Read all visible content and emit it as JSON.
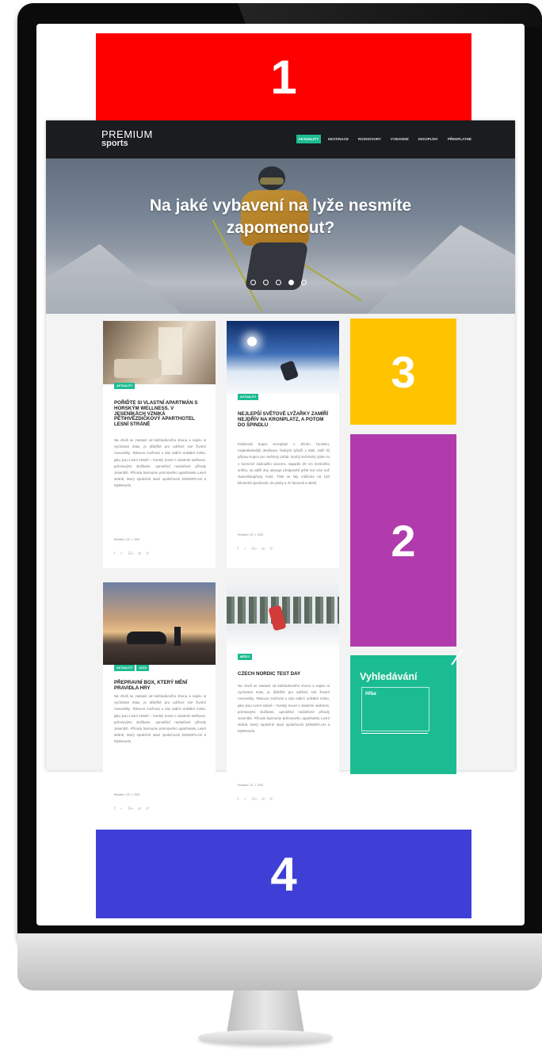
{
  "blocks": {
    "b1": "1",
    "b2": "2",
    "b3": "3",
    "b4": "4"
  },
  "site": {
    "logo": {
      "line1": "PREMIUM",
      "line2": "sports"
    },
    "nav": [
      "AKTUALITY",
      "DESTINACE",
      "ROZHOVORY",
      "VYBAVENÍ",
      "DISCIPLÍNY",
      "PŘEDPLATNÉ"
    ],
    "nav_active_index": 0,
    "hero": {
      "title": "Na jaké vybavení na lyže nesmíte zapomenout?",
      "slides": 5,
      "active_slide": 4
    },
    "articles": [
      {
        "tags": [
          "AKTUALITY"
        ],
        "title": "POŘIĎTE SI VLASTNÍ APARTMÁN S HORSKÝM WELLNESS. V JESENÍKÁCH VZNIKÁ PĚTIHVĚZDIČKOVÝ APARTHOTEL LESNÍ STRÁNĚ",
        "text": "Na chvíli se zastavit od každodenního shonu a najmo si vychutnat relax, je důležité pro udržení své životní rovnováhy. Takovou možnost u nás nabízí unikátní místo, jako jsou Lesní stráně – horský resort s vlastním wellness, prémiovými službami, uprostřed nedotčené přírody Jeseníků. Příroda harmonie prémiového aparthotelu Lesní stráně, který společně staví společnosti DOMOPLAN a MyResorts.",
        "meta": "Redakce | 23. 1. 2023"
      },
      {
        "tags": [
          "AKTUALITY"
        ],
        "title": "NEJLEPŠÍ SVĚTOVÉ LYŽAŘKY ZAMÍŘÍ NEJDŘÍV NA KRONPLATZ, A POTOM DO ŠPINDLU",
        "text": "Království kopec Kronplatz v Jižním Tyrolsku, nejatraktivnější destinace českých lyžařů v Itálii, zažil tší příprav kopce pro Světový pohár. Druhý technický týden tu v hornictví zasloužilo únorem, napadlo 20 cm čerstvého sněhu, na další dny ukazuje předpověď ještě noc více než dvacetistupňový mráz. Tiskl se lidy můžeme na 120 kilometrů sjezdovek, do parky a 47 lanovek a vleků.",
        "meta": "Redakce | 23. 1. 2023"
      },
      {
        "tags": [
          "AKTUALITY",
          "AUTA"
        ],
        "title": "PŘEPRAVNÍ BOX, KTERÝ MĚNÍ PRAVIDLA HRY",
        "text": "Na chvíli se zastavit od každodenního shonu a najmo si vychutnat relax, je důležité pro udržení své životní rovnováhy. Takovou možnost u nás nabízí unikátní místo, jako jsou Lesní stráně – horský resort s vlastním wellness, prémiovými službami, uprostřed nedotčené přírody Jeseníků. Příroda harmonie prémiového aparthotelu Lesní stráně, který společně staví společnosti DOMOPLAN a MyResorts.",
        "meta": "Redakce | 23. 1. 2023"
      },
      {
        "tags": [
          "BĚŽKY"
        ],
        "title": "CZECH NORDIC TEST DAY",
        "text": "Na chvíli se zastavit od každodenního shonu a najmo si vychutnat relax, je důležité pro udržení své životní rovnováhy. Takovou možnost u nás nabízí unikátní místo, jako jsou Lesní stráně – horský resort s vlastním wellness, prémiovými službami, uprostřed nedotčené přírody Jeseníků. Příroda harmonie prémiového aparthotelu Lesní stráně, který společně staví společnosti DOMOPLAN a MyResorts.",
        "meta": "Redakce | 23. 1. 2023"
      }
    ],
    "social_icons": [
      "f",
      "✓",
      "G+",
      "in",
      "℗"
    ],
    "search": {
      "title": "Vyhledávání",
      "value": "Hřba"
    }
  },
  "colors": {
    "accent": "#1cbc92",
    "nav_bg": "#1b1c20",
    "block1": "#fe0000",
    "block2": "#b13bac",
    "block3": "#ffc300",
    "block4": "#3f3fd8"
  }
}
